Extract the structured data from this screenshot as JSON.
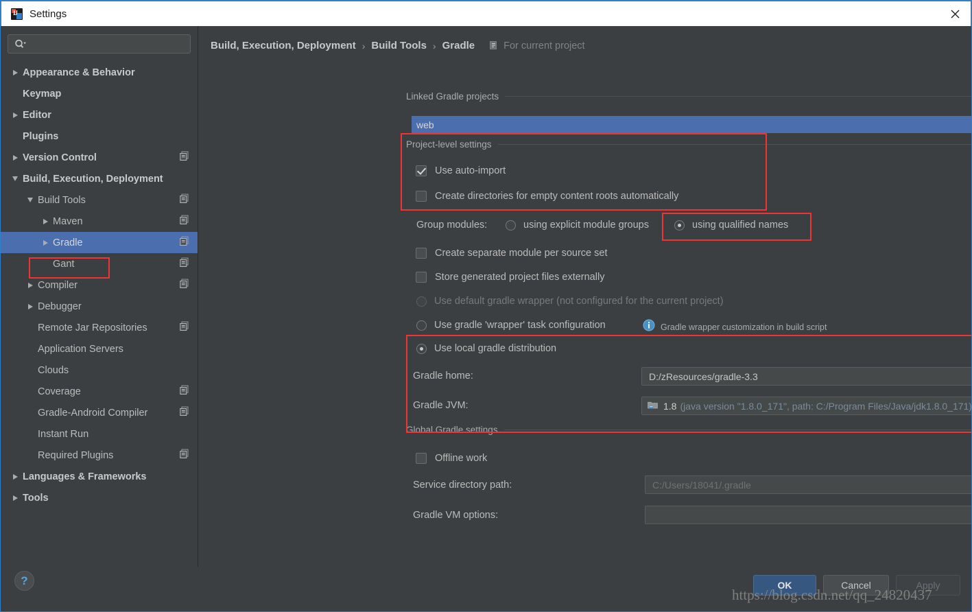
{
  "window": {
    "title": "Settings",
    "logo_icon": "intellij-idea-logo-icon",
    "close_icon": "close-icon"
  },
  "sidebar": {
    "search": {
      "placeholder": "",
      "value": "",
      "icon": "search-icon"
    },
    "items": [
      {
        "label": "Appearance & Behavior",
        "indent": 0,
        "arrow": "right",
        "bold": true,
        "project_icon": false,
        "selected": false
      },
      {
        "label": "Keymap",
        "indent": 0,
        "arrow": "none",
        "bold": true,
        "project_icon": false,
        "selected": false
      },
      {
        "label": "Editor",
        "indent": 0,
        "arrow": "right",
        "bold": true,
        "project_icon": false,
        "selected": false
      },
      {
        "label": "Plugins",
        "indent": 0,
        "arrow": "none",
        "bold": true,
        "project_icon": false,
        "selected": false
      },
      {
        "label": "Version Control",
        "indent": 0,
        "arrow": "right",
        "bold": true,
        "project_icon": true,
        "selected": false
      },
      {
        "label": "Build, Execution, Deployment",
        "indent": 0,
        "arrow": "down",
        "bold": true,
        "project_icon": false,
        "selected": false
      },
      {
        "label": "Build Tools",
        "indent": 1,
        "arrow": "down",
        "bold": false,
        "project_icon": true,
        "selected": false
      },
      {
        "label": "Maven",
        "indent": 2,
        "arrow": "right",
        "bold": false,
        "project_icon": true,
        "selected": false
      },
      {
        "label": "Gradle",
        "indent": 2,
        "arrow": "right",
        "bold": false,
        "project_icon": true,
        "selected": true
      },
      {
        "label": "Gant",
        "indent": 2,
        "arrow": "none",
        "bold": false,
        "project_icon": true,
        "selected": false
      },
      {
        "label": "Compiler",
        "indent": 1,
        "arrow": "right",
        "bold": false,
        "project_icon": true,
        "selected": false
      },
      {
        "label": "Debugger",
        "indent": 1,
        "arrow": "right",
        "bold": false,
        "project_icon": false,
        "selected": false
      },
      {
        "label": "Remote Jar Repositories",
        "indent": 1,
        "arrow": "none",
        "bold": false,
        "project_icon": true,
        "selected": false
      },
      {
        "label": "Application Servers",
        "indent": 1,
        "arrow": "none",
        "bold": false,
        "project_icon": false,
        "selected": false
      },
      {
        "label": "Clouds",
        "indent": 1,
        "arrow": "none",
        "bold": false,
        "project_icon": false,
        "selected": false
      },
      {
        "label": "Coverage",
        "indent": 1,
        "arrow": "none",
        "bold": false,
        "project_icon": true,
        "selected": false
      },
      {
        "label": "Gradle-Android Compiler",
        "indent": 1,
        "arrow": "none",
        "bold": false,
        "project_icon": true,
        "selected": false
      },
      {
        "label": "Instant Run",
        "indent": 1,
        "arrow": "none",
        "bold": false,
        "project_icon": false,
        "selected": false
      },
      {
        "label": "Required Plugins",
        "indent": 1,
        "arrow": "none",
        "bold": false,
        "project_icon": true,
        "selected": false
      },
      {
        "label": "Languages & Frameworks",
        "indent": 0,
        "arrow": "right",
        "bold": true,
        "project_icon": false,
        "selected": false
      },
      {
        "label": "Tools",
        "indent": 0,
        "arrow": "right",
        "bold": true,
        "project_icon": false,
        "selected": false
      }
    ]
  },
  "breadcrumb": {
    "crumb1": "Build, Execution, Deployment",
    "crumb2": "Build Tools",
    "crumb3": "Gradle",
    "separator": "›",
    "scope_note": "For current project",
    "scope_icon": "project-scope-icon"
  },
  "linked_projects": {
    "group_title": "Linked Gradle projects",
    "selected_item": "web"
  },
  "project_settings": {
    "group_title": "Project-level settings",
    "use_auto_import": {
      "label": "Use auto-import",
      "checked": true
    },
    "create_dirs": {
      "label": "Create directories for empty content roots automatically",
      "checked": false
    },
    "group_modules_label": "Group modules:",
    "group_modules_options": [
      {
        "label": "using explicit module groups",
        "selected": false
      },
      {
        "label": "using qualified names",
        "selected": true
      }
    ],
    "separate_module": {
      "label": "Create separate module per source set",
      "checked": false
    },
    "store_external": {
      "label": "Store generated project files externally",
      "checked": false
    }
  },
  "distribution": {
    "default_wrapper": {
      "label": "Use default gradle wrapper (not configured for the current project)",
      "selected": false,
      "disabled": true
    },
    "task_wrapper": {
      "label": "Use gradle 'wrapper' task configuration",
      "selected": false
    },
    "wrapper_hint": {
      "text": "Gradle wrapper customization in build script",
      "icon": "info-icon"
    },
    "local_dist": {
      "label": "Use local gradle distribution",
      "selected": true
    },
    "gradle_home": {
      "label": "Gradle home:",
      "value": "D:/zResources/gradle-3.3",
      "browse_label": "..."
    },
    "gradle_jvm": {
      "label": "Gradle JVM:",
      "icon": "jdk-folder-icon",
      "value_main": "1.8",
      "value_detail": "(java version \"1.8.0_171\", path: C:/Program Files/Java/jdk1.8.0_171)",
      "browse_label": "...",
      "dropdown_icon": "chevron-down-icon"
    }
  },
  "global_settings": {
    "group_title": "Global Gradle settings",
    "offline_work": {
      "label": "Offline work",
      "checked": false
    },
    "service_dir": {
      "label": "Service directory path:",
      "value": "C:/Users/18041/.gradle",
      "browse_label": "..."
    },
    "vm_options": {
      "label": "Gradle VM options:",
      "value": ""
    }
  },
  "footer": {
    "help_label": "?",
    "ok_label": "OK",
    "cancel_label": "Cancel",
    "apply_label": "Apply"
  },
  "watermark": "https://blog.csdn.net/qq_24820437",
  "colors": {
    "accent_blue": "#4b6eaf",
    "ok_button": "#365880",
    "annotation_red": "#f03434",
    "panel_bg": "#3c3f41",
    "title_bar": "#ffffff"
  }
}
